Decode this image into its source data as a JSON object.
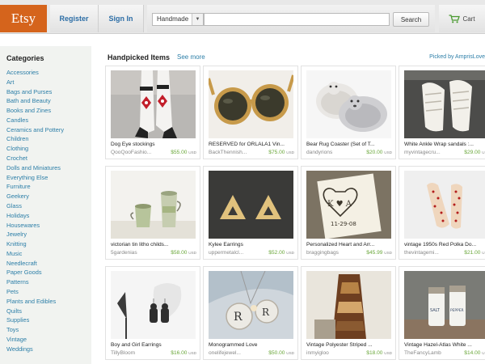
{
  "header": {
    "logo": "Etsy",
    "register": "Register",
    "sign_in": "Sign In",
    "search_category": "Handmade",
    "search_placeholder": "",
    "search_button": "Search",
    "cart_label": "Cart"
  },
  "sidebar": {
    "title": "Categories",
    "items": [
      "Accessories",
      "Art",
      "Bags and Purses",
      "Bath and Beauty",
      "Books and Zines",
      "Candles",
      "Ceramics and Pottery",
      "Children",
      "Clothing",
      "Crochet",
      "Dolls and Miniatures",
      "Everything Else",
      "Furniture",
      "Geekery",
      "Glass",
      "Holidays",
      "Housewares",
      "Jewelry",
      "Knitting",
      "Music",
      "Needlecraft",
      "Paper Goods",
      "Patterns",
      "Pets",
      "Plants and Edibles",
      "Quilts",
      "Supplies",
      "Toys",
      "Vintage",
      "Weddings"
    ]
  },
  "main": {
    "title": "Handpicked Items",
    "see_more": "See more",
    "picked_by": "Picked by AmprisLove",
    "currency": "USD",
    "items": [
      {
        "title": "Dog Eye stockings",
        "shop": "QooQooFashio...",
        "price": "$55.00"
      },
      {
        "title": "RESERVED for ORLALA1 Vin...",
        "shop": "BackThennish...",
        "price": "$75.00"
      },
      {
        "title": "Bear Rug Coaster (Set of T...",
        "shop": "dandyrions",
        "price": "$20.00"
      },
      {
        "title": "White Ankle Wrap sandals :...",
        "shop": "myvintagecru...",
        "price": "$29.00"
      },
      {
        "title": "victorian tin litho childs...",
        "shop": "5gardenias",
        "price": "$58.00"
      },
      {
        "title": "Kylee Earrings",
        "shop": "uppermetalcl...",
        "price": "$52.00"
      },
      {
        "title": "Personalized Heart and Arr...",
        "shop": "braggingbags",
        "price": "$45.99"
      },
      {
        "title": "vintage 1950s Red Polka Do...",
        "shop": "thevintagemi...",
        "price": "$21.00"
      },
      {
        "title": "Boy and Girl Earrings",
        "shop": "TillyBloom",
        "price": "$16.00"
      },
      {
        "title": "Monogrammed Love",
        "shop": "onelifejewel...",
        "price": "$50.00"
      },
      {
        "title": "Vintage Polyester Striped ...",
        "shop": "inmyigloo",
        "price": "$18.00"
      },
      {
        "title": "Vintage Hazel-Atlas White ...",
        "shop": "TheFancyLamb",
        "price": "$14.00"
      }
    ]
  },
  "colors": {
    "brand": "#d5641c",
    "link": "#2d7fa8",
    "price": "#6aa73a"
  },
  "thumb_text": {
    "heart_initials": "K ♥ A",
    "heart_date": "11-29-08",
    "pendant_1": "R",
    "pendant_2": "R",
    "jar_1": "SALT",
    "jar_2": "PEPPER"
  }
}
